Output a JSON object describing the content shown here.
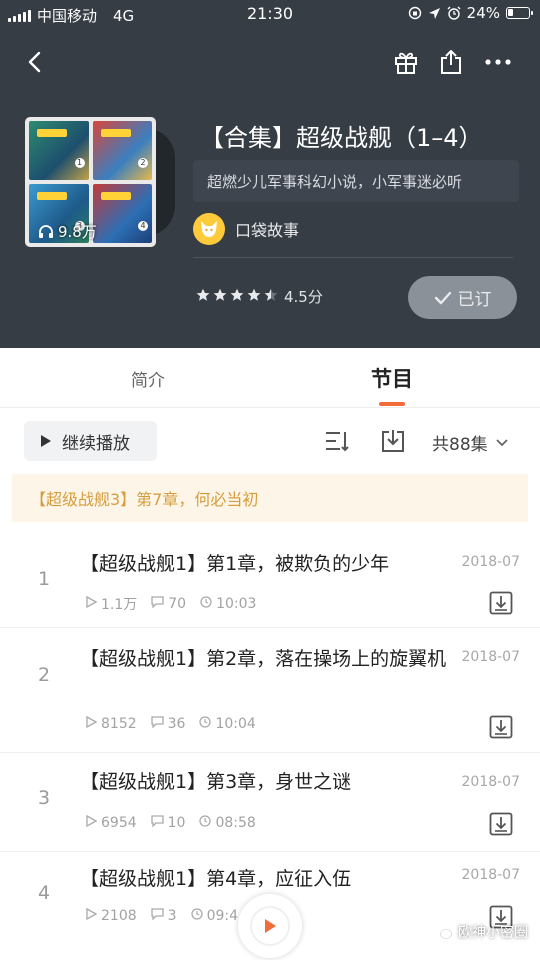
{
  "status_bar": {
    "carrier": "中国移动",
    "network": "4G",
    "time": "21:30",
    "battery": "24%",
    "battery_level": 0.24
  },
  "album": {
    "title": "【合集】超级战舰（1–4）",
    "description": "超燃少儿军事科幻小说，小军事迷必听",
    "plays": "9.8万",
    "author": "口袋故事",
    "rating_stars": 4.5,
    "rating_text": "4.5分",
    "subscribe_label": "已订"
  },
  "tabs": {
    "intro": "简介",
    "programs": "节目"
  },
  "toolbar": {
    "continue_label": "继续播放",
    "episode_count": "共88集"
  },
  "history": {
    "text": "【超级战舰3】第7章，何必当初"
  },
  "episodes": [
    {
      "num": "1",
      "title": "【超级战舰1】第1章，被欺负的少年",
      "plays": "1.1万",
      "comments": "70",
      "duration": "10:03",
      "date": "2018-07"
    },
    {
      "num": "2",
      "title": "【超级战舰1】第2章，落在操场上的旋翼机",
      "plays": "8152",
      "comments": "36",
      "duration": "10:04",
      "date": "2018-07"
    },
    {
      "num": "3",
      "title": "【超级战舰1】第3章，身世之谜",
      "plays": "6954",
      "comments": "10",
      "duration": "08:58",
      "date": "2018-07"
    },
    {
      "num": "4",
      "title": "【超级战舰1】第4章，应征入伍",
      "plays": "2108",
      "comments": "3",
      "duration": "09:4",
      "date": "2018-07"
    }
  ],
  "watermark": "欧神小密圈",
  "colors": {
    "header_bg": "#363d45",
    "accent": "#f26b3a",
    "history_text": "#d69d3e",
    "history_bg": "#fdf6e8",
    "subscribe_bg": "#8b9198"
  },
  "icons": {
    "back": "back-arrow-icon",
    "gift": "gift-icon",
    "share": "share-icon",
    "more": "more-dots-icon",
    "sort": "sort-icon",
    "download": "download-icon",
    "play": "play-icon",
    "comment": "comment-icon",
    "clock": "clock-icon"
  }
}
